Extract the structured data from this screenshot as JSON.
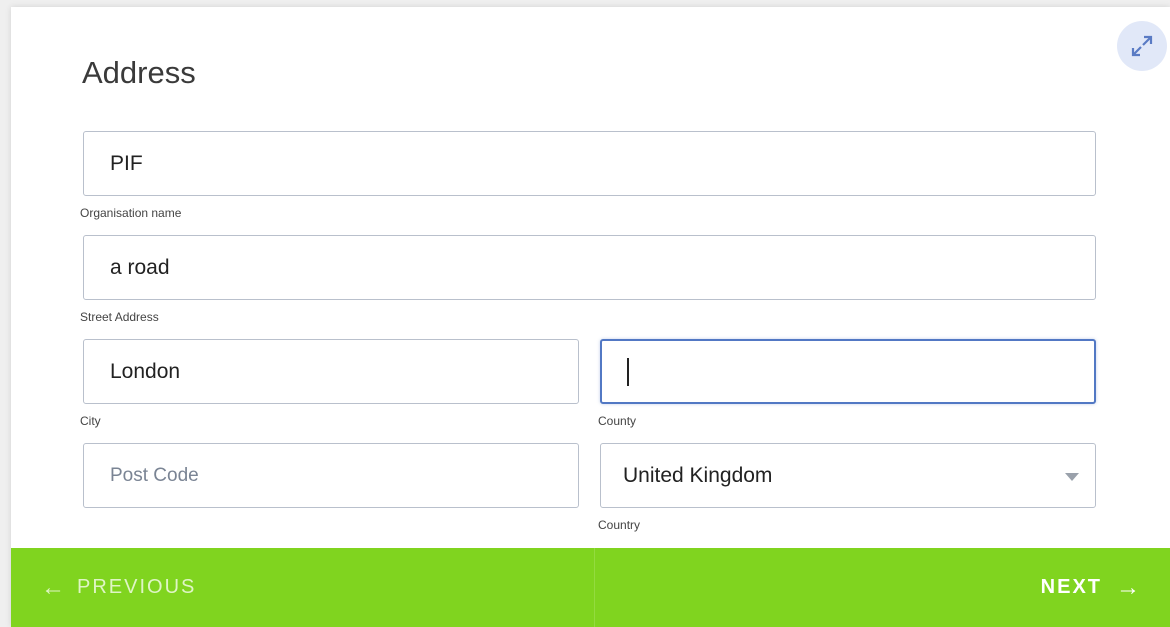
{
  "form": {
    "title": "Address",
    "organisation": {
      "value": "PIF",
      "label": "Organisation name"
    },
    "street": {
      "value": "a road",
      "label": "Street Address"
    },
    "city": {
      "value": "London",
      "label": "City"
    },
    "county": {
      "value": "",
      "label": "County"
    },
    "postcode": {
      "value": "",
      "placeholder": "Post Code"
    },
    "country": {
      "value": "United Kingdom",
      "label": "Country"
    }
  },
  "footer": {
    "previous_label": "PREVIOUS",
    "previous_arrow": "←",
    "next_label": "NEXT",
    "next_arrow": "→"
  },
  "icons": {
    "expand": "expand-icon",
    "dropdown": "chevron-down-icon"
  },
  "colors": {
    "accent_green": "#80d41f",
    "focus_blue": "#5278c4",
    "expand_bg": "#e1e8f8"
  }
}
